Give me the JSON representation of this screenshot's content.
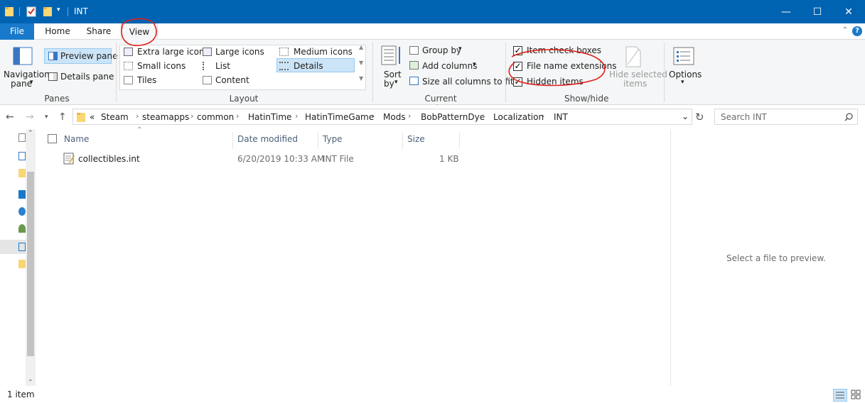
{
  "window": {
    "title": "INT",
    "minimize_glyph": "—",
    "maximize_glyph": "☐",
    "close_glyph": "✕"
  },
  "tabs": [
    {
      "label": "File"
    },
    {
      "label": "Home"
    },
    {
      "label": "Share"
    },
    {
      "label": "View"
    }
  ],
  "ribbon": {
    "panes": {
      "navigation_pane": "Navigation",
      "navigation_pane_2": "pane",
      "preview_pane": "Preview pane",
      "details_pane": "Details pane",
      "group_label": "Panes"
    },
    "layout": {
      "items": [
        "Extra large icons",
        "Large icons",
        "Medium icons",
        "Small icons",
        "List",
        "Details",
        "Tiles",
        "Content"
      ],
      "selected": "Details",
      "group_label": "Layout"
    },
    "current_view": {
      "sort_by": "Sort",
      "sort_by_2": "by",
      "group_by": "Group by",
      "add_columns": "Add columns",
      "size_all_columns": "Size all columns to fit",
      "group_label": "Current view"
    },
    "show_hide": {
      "item_check_boxes": "Item check boxes",
      "file_name_extensions": "File name extensions",
      "hidden_items": "Hidden items",
      "hide_selected": "Hide selected",
      "hide_selected_2": "items",
      "group_label": "Show/hide",
      "checked": [
        true,
        true,
        true
      ]
    },
    "options": "Options"
  },
  "address": {
    "overflow": "«",
    "crumbs": [
      "Steam",
      "steamapps",
      "common",
      "HatinTime",
      "HatinTimeGame",
      "Mods",
      "BobPatternDye",
      "Localization",
      "INT"
    ]
  },
  "search": {
    "placeholder": "Search INT"
  },
  "columns": [
    "Name",
    "Date modified",
    "Type",
    "Size"
  ],
  "files": [
    {
      "name": "collectibles.int",
      "date": "6/20/2019 10:33 AM",
      "type": "INT File",
      "size": "1 KB"
    }
  ],
  "preview_message": "Select a file to preview.",
  "status": {
    "count": "1 item"
  },
  "colors": {
    "titlebar": "#0063b1",
    "file_tab": "#1979ca",
    "selection": "#cce4f7",
    "annotation": "#e0201b"
  }
}
